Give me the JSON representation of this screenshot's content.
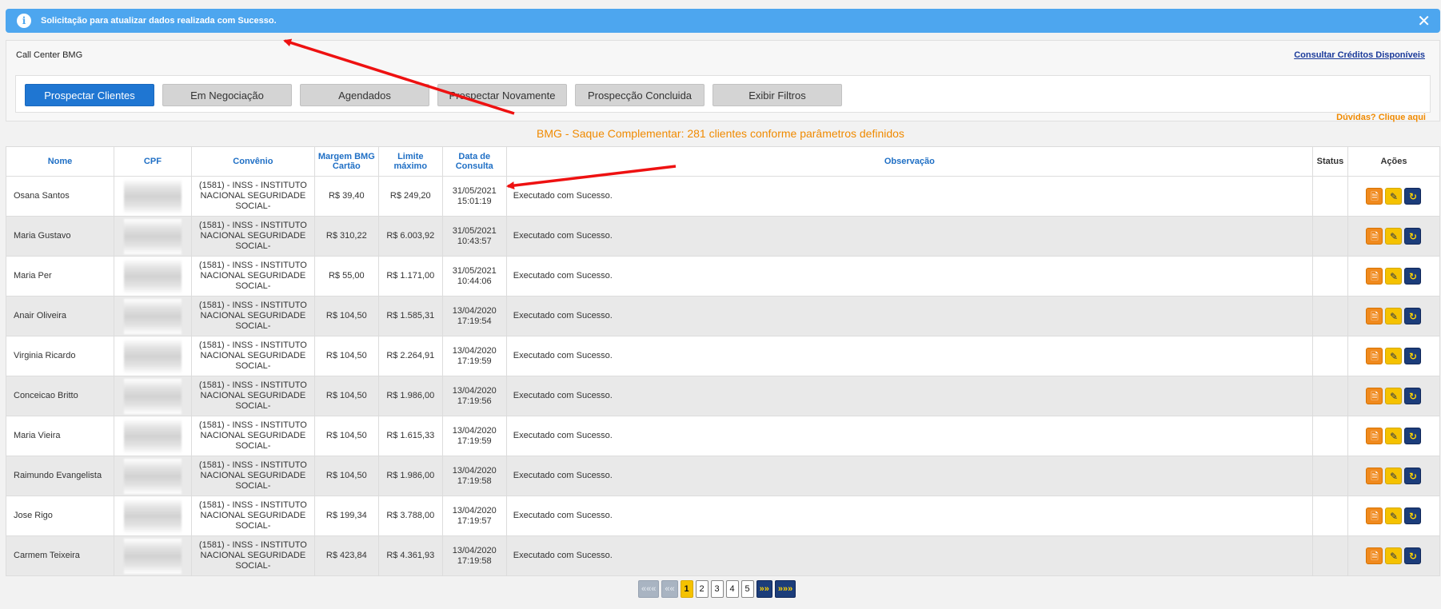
{
  "alert": {
    "message": "Solicitação para atualizar dados realizada com Sucesso.",
    "close": "✕"
  },
  "panel": {
    "title": "Call Center BMG",
    "consult_link": "Consultar Créditos Disponíveis",
    "help_link": "Dúvidas? Clique aqui"
  },
  "tabs": [
    {
      "label": "Prospectar Clientes",
      "active": true
    },
    {
      "label": "Em Negociação"
    },
    {
      "label": "Agendados"
    },
    {
      "label": "Prospectar Novamente"
    },
    {
      "label": "Prospecção Concluida"
    },
    {
      "label": "Exibir Filtros"
    }
  ],
  "summary": "BMG - Saque Complementar: 281 clientes conforme parâmetros definidos",
  "table": {
    "headers": {
      "nome": "Nome",
      "cpf": "CPF",
      "convenio": "Convênio",
      "margem": "Margem BMG Cartão",
      "limite": "Limite máximo",
      "data": "Data de Consulta",
      "obs": "Observação",
      "status": "Status",
      "acoes": "Ações"
    },
    "rows": [
      {
        "nome": "Osana Santos",
        "convenio": "(1581) - INSS - INSTITUTO NACIONAL SEGURIDADE SOCIAL-",
        "margem": "R$ 39,40",
        "limite": "R$ 249,20",
        "data": "31/05/2021",
        "hora": "15:01:19",
        "obs": "Executado com Sucesso.",
        "status": ""
      },
      {
        "nome": "Maria Gustavo",
        "convenio": "(1581) - INSS - INSTITUTO NACIONAL SEGURIDADE SOCIAL-",
        "margem": "R$ 310,22",
        "limite": "R$ 6.003,92",
        "data": "31/05/2021",
        "hora": "10:43:57",
        "obs": "Executado com Sucesso.",
        "status": ""
      },
      {
        "nome": "Maria Per",
        "convenio": "(1581) - INSS - INSTITUTO NACIONAL SEGURIDADE SOCIAL-",
        "margem": "R$ 55,00",
        "limite": "R$ 1.171,00",
        "data": "31/05/2021",
        "hora": "10:44:06",
        "obs": "Executado com Sucesso.",
        "status": ""
      },
      {
        "nome": "Anair Oliveira",
        "convenio": "(1581) - INSS - INSTITUTO NACIONAL SEGURIDADE SOCIAL-",
        "margem": "R$ 104,50",
        "limite": "R$ 1.585,31",
        "data": "13/04/2020",
        "hora": "17:19:54",
        "obs": "Executado com Sucesso.",
        "status": ""
      },
      {
        "nome": "Virginia Ricardo",
        "convenio": "(1581) - INSS - INSTITUTO NACIONAL SEGURIDADE SOCIAL-",
        "margem": "R$ 104,50",
        "limite": "R$ 2.264,91",
        "data": "13/04/2020",
        "hora": "17:19:59",
        "obs": "Executado com Sucesso.",
        "status": ""
      },
      {
        "nome": "Conceicao Britto",
        "convenio": "(1581) - INSS - INSTITUTO NACIONAL SEGURIDADE SOCIAL-",
        "margem": "R$ 104,50",
        "limite": "R$ 1.986,00",
        "data": "13/04/2020",
        "hora": "17:19:56",
        "obs": "Executado com Sucesso.",
        "status": ""
      },
      {
        "nome": "Maria Vieira",
        "convenio": "(1581) - INSS - INSTITUTO NACIONAL SEGURIDADE SOCIAL-",
        "margem": "R$ 104,50",
        "limite": "R$ 1.615,33",
        "data": "13/04/2020",
        "hora": "17:19:59",
        "obs": "Executado com Sucesso.",
        "status": ""
      },
      {
        "nome": "Raimundo Evangelista",
        "convenio": "(1581) - INSS - INSTITUTO NACIONAL SEGURIDADE SOCIAL-",
        "margem": "R$ 104,50",
        "limite": "R$ 1.986,00",
        "data": "13/04/2020",
        "hora": "17:19:58",
        "obs": "Executado com Sucesso.",
        "status": ""
      },
      {
        "nome": "Jose Rigo",
        "convenio": "(1581) - INSS - INSTITUTO NACIONAL SEGURIDADE SOCIAL-",
        "margem": "R$ 199,34",
        "limite": "R$ 3.788,00",
        "data": "13/04/2020",
        "hora": "17:19:57",
        "obs": "Executado com Sucesso.",
        "status": ""
      },
      {
        "nome": "Carmem Teixeira",
        "convenio": "(1581) - INSS - INSTITUTO NACIONAL SEGURIDADE SOCIAL-",
        "margem": "R$ 423,84",
        "limite": "R$ 4.361,93",
        "data": "13/04/2020",
        "hora": "17:19:58",
        "obs": "Executado com Sucesso.",
        "status": ""
      }
    ],
    "action_icons": [
      "document-icon",
      "edit-icon",
      "refresh-icon"
    ]
  },
  "pagination": {
    "first": "«««",
    "prev": "««",
    "pages": [
      "1",
      "2",
      "3",
      "4",
      "5"
    ],
    "current": "1",
    "next": "»»",
    "last": "»»»"
  },
  "colors": {
    "alert_bg": "#4da6ef",
    "primary": "#1f76d2",
    "accent_orange": "#f08a00",
    "header_blue": "#1f6fc5",
    "annotation_arrow": "#ee1111"
  }
}
